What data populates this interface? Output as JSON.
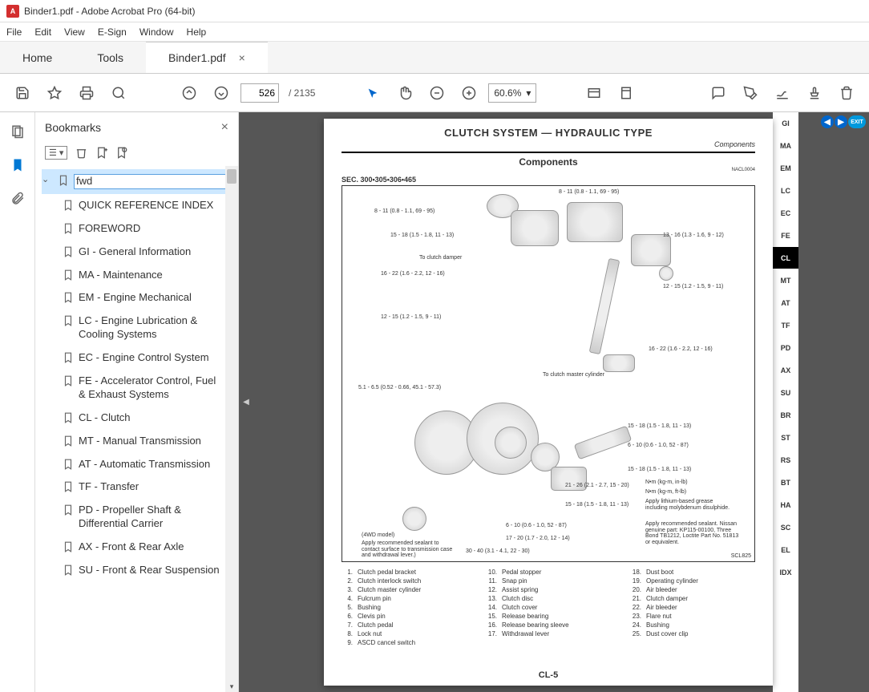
{
  "window": {
    "title": "Binder1.pdf - Adobe Acrobat Pro (64-bit)"
  },
  "menu": {
    "file": "File",
    "edit": "Edit",
    "view": "View",
    "esign": "E-Sign",
    "window": "Window",
    "help": "Help"
  },
  "tabs": {
    "home": "Home",
    "tools": "Tools",
    "doc": "Binder1.pdf"
  },
  "toolbar": {
    "page_current": "526",
    "page_total": "/ 2135",
    "zoom": "60.6%"
  },
  "panel": {
    "title": "Bookmarks"
  },
  "bookmarks": {
    "root": "fwd",
    "items": [
      "QUICK REFERENCE INDEX",
      "FOREWORD",
      "GI - General Information",
      "MA - Maintenance",
      "EM - Engine Mechanical",
      "LC - Engine Lubrication & Cooling Systems",
      "EC - Engine Control System",
      "FE - Accelerator Control, Fuel & Exhaust Systems",
      "CL - Clutch",
      "MT - Manual Transmission",
      "AT - Automatic Transmission",
      "TF - Transfer",
      "PD - Propeller Shaft & Differential Carrier",
      "AX - Front & Rear Axle",
      "SU - Front & Rear Suspension"
    ]
  },
  "page": {
    "title": "CLUTCH SYSTEM — HYDRAULIC TYPE",
    "subtitle": "Components",
    "components_heading": "Components",
    "sec": "SEC. 300•305•306•465",
    "torques": {
      "t1": "8 - 11 (0.8 - 1.1, 69 - 95)",
      "t2": "8 - 11 (0.8 - 1.1, 69 - 95)",
      "t3": "15 - 18 (1.5 - 1.8, 11 - 13)",
      "t4": "16 - 22 (1.6 - 2.2, 12 - 16)",
      "t5": "12 - 15 (1.2 - 1.5, 9 - 11)",
      "t6": "13 - 16 (1.3 - 1.6, 9 - 12)",
      "t7": "12 - 15 (1.2 - 1.5, 9 - 11)",
      "t8": "16 - 22 (1.6 - 2.2, 12 - 16)",
      "t9": "5.1 - 6.5 (0.52 - 0.66, 45.1 - 57.3)",
      "t10": "15 - 18 (1.5 - 1.8, 11 - 13)",
      "t11": "6 - 10 (0.6 - 1.0, 52 - 87)",
      "t12": "15 - 18 (1.5 - 1.8, 11 - 13)",
      "t13": "21 - 26 (2.1 - 2.7, 15 - 20)",
      "t14": "15 - 18 (1.5 - 1.8, 11 - 13)",
      "t15": "6 - 10 (0.6 - 1.0, 52 - 87)",
      "t16": "17 - 20 (1.7 - 2.0, 12 - 14)",
      "t17": "30 - 40 (3.1 - 4.1, 22 - 30)"
    },
    "callouts": {
      "damper": "To clutch damper",
      "master": "To clutch master cylinder",
      "wd4": "(4WD model)",
      "sealant": "Apply recommended sealant to contact surface to transmission case and withdrawal lever.)",
      "unit_nm_in": "N•m (kg-m, in-lb)",
      "unit_nm_ft": "N•m (kg-m, ft-lb)",
      "grease": "Apply lithium-based grease including molybdenum disulphide.",
      "sealant2": "Apply recommended sealant. Nissan genuine part: KP115-00100, Three Bond TB1212, Loctite Part No. 51813 or equivalent."
    },
    "diagram_code": "SCL825",
    "ref_code": "NACL0004",
    "legend": [
      {
        "n": "1.",
        "t": "Clutch pedal bracket"
      },
      {
        "n": "2.",
        "t": "Clutch interlock switch"
      },
      {
        "n": "3.",
        "t": "Clutch master cylinder"
      },
      {
        "n": "4.",
        "t": "Fulcrum pin"
      },
      {
        "n": "5.",
        "t": "Bushing"
      },
      {
        "n": "6.",
        "t": "Clevis pin"
      },
      {
        "n": "7.",
        "t": "Clutch pedal"
      },
      {
        "n": "8.",
        "t": "Lock nut"
      },
      {
        "n": "9.",
        "t": "ASCD cancel switch"
      },
      {
        "n": "10.",
        "t": "Pedal stopper"
      },
      {
        "n": "11.",
        "t": "Snap pin"
      },
      {
        "n": "12.",
        "t": "Assist spring"
      },
      {
        "n": "13.",
        "t": "Clutch disc"
      },
      {
        "n": "14.",
        "t": "Clutch cover"
      },
      {
        "n": "15.",
        "t": "Release bearing"
      },
      {
        "n": "16.",
        "t": "Release bearing sleeve"
      },
      {
        "n": "17.",
        "t": "Withdrawal lever"
      },
      {
        "n": "18.",
        "t": "Dust boot"
      },
      {
        "n": "19.",
        "t": "Operating cylinder"
      },
      {
        "n": "20.",
        "t": "Air bleeder"
      },
      {
        "n": "21.",
        "t": "Clutch damper"
      },
      {
        "n": "22.",
        "t": "Air bleeder"
      },
      {
        "n": "23.",
        "t": "Flare nut"
      },
      {
        "n": "24.",
        "t": "Bushing"
      },
      {
        "n": "25.",
        "t": "Dust cover clip"
      }
    ],
    "pagenum": "CL-5"
  },
  "index_tabs": [
    "GI",
    "MA",
    "EM",
    "LC",
    "EC",
    "FE",
    "CL",
    "MT",
    "AT",
    "TF",
    "PD",
    "AX",
    "SU",
    "BR",
    "ST",
    "RS",
    "BT",
    "HA",
    "SC",
    "EL",
    "IDX"
  ],
  "nav": {
    "exit": "EXIT"
  }
}
